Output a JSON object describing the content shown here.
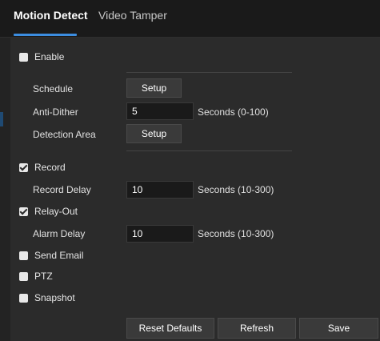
{
  "tabs": [
    {
      "label": "Motion Detect",
      "active": true
    },
    {
      "label": "Video Tamper",
      "active": false
    }
  ],
  "enable": {
    "label": "Enable",
    "checked": false
  },
  "schedule": {
    "label": "Schedule",
    "button": "Setup"
  },
  "anti_dither": {
    "label": "Anti-Dither",
    "value": "5",
    "suffix": "Seconds (0-100)"
  },
  "detection_area": {
    "label": "Detection Area",
    "button": "Setup"
  },
  "record": {
    "label": "Record",
    "checked": true
  },
  "record_delay": {
    "label": "Record Delay",
    "value": "10",
    "suffix": "Seconds (10-300)"
  },
  "relay_out": {
    "label": "Relay-Out",
    "checked": true
  },
  "alarm_delay": {
    "label": "Alarm Delay",
    "value": "10",
    "suffix": "Seconds (10-300)"
  },
  "send_email": {
    "label": "Send Email",
    "checked": false
  },
  "ptz": {
    "label": "PTZ",
    "checked": false
  },
  "snapshot": {
    "label": "Snapshot",
    "checked": false
  },
  "footer": {
    "reset_label": "Reset Defaults",
    "refresh_label": "Refresh",
    "save_label": "Save"
  },
  "colors": {
    "accent": "#3c8de0",
    "background": "#2b2b2b",
    "tabbar": "#1a1a1a"
  }
}
